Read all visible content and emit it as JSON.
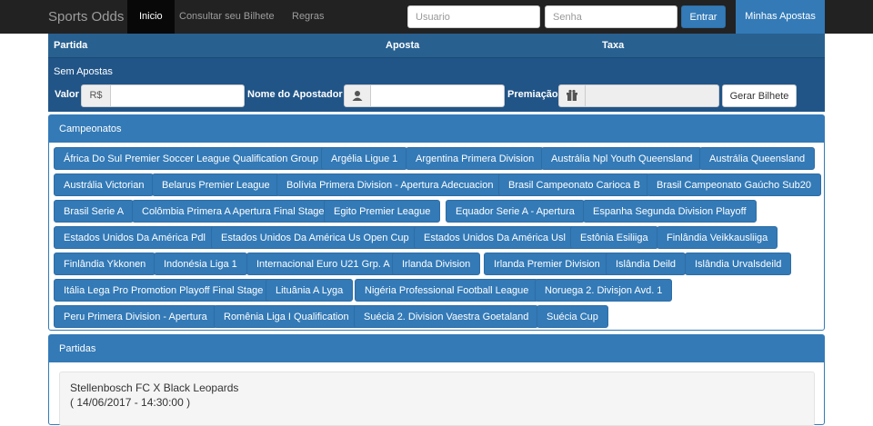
{
  "navbar": {
    "brand": "Sports Odds",
    "links": [
      "Inicio",
      "Consultar seu Bilhete",
      "Regras"
    ],
    "username_placeholder": "Usuario",
    "password_placeholder": "Senha",
    "login_label": "Entrar",
    "my_bets_label": "Minhas Apostas"
  },
  "slip": {
    "columns": [
      "Partida",
      "Aposta",
      "Taxa"
    ],
    "empty_text": "Sem Apostas",
    "valor_label": "Valor",
    "currency": "R$",
    "name_label": "Nome do Apostador",
    "prize_label": "Premiação",
    "generate_label": "Gerar Bilhete"
  },
  "campeonatos": {
    "title": "Campeonatos",
    "items": [
      "África Do Sul Premier Soccer League Qualification Group",
      "Argélia Ligue 1",
      "Argentina Primera Division",
      "Austrália Npl Youth Queensland",
      "Austrália Queensland",
      "Austrália Victorian",
      "Belarus Premier League",
      "Bolívia Primera Division - Apertura Adecuacion",
      "Brasil Campeonato Carioca B",
      "Brasil Campeonato Gaúcho Sub20",
      "Brasil Serie A",
      "Colômbia Primera A Apertura Final Stage",
      "Egito Premier League",
      "Equador Serie A - Apertura",
      "Espanha Segunda Division Playoff",
      "Estados Unidos Da América Pdl",
      "Estados Unidos Da América Us Open Cup",
      "Estados Unidos Da América Usl",
      "Estônia Esiliiga",
      "Finlândia Veikkausliiga",
      "Finlândia Ykkonen",
      "Indonésia Liga 1",
      "Internacional Euro U21 Grp. A",
      "Irlanda Division",
      "Irlanda Premier Division",
      "Islândia Deild",
      "Islândia Urvalsdeild",
      "Itália Lega Pro Promotion Playoff Final Stage",
      "Lituânia A Lyga",
      "Nigéria Professional Football League",
      "Noruega 2. Divisjon Avd. 1",
      "Peru Primera Division - Apertura",
      "Romênia Liga I Qualification",
      "Suécia 2. Division Vaestra Goetaland",
      "Suécia Cup"
    ]
  },
  "partidas": {
    "title": "Partidas",
    "matches": [
      {
        "teams": "Stellenbosch FC X Black Leopards",
        "datetime": "( 14/06/2017 - 14:30:00 )"
      }
    ]
  },
  "colors": {
    "primary": "#337ab7",
    "navbar": "#222222",
    "slip": "#215588"
  },
  "icons": {
    "user": "user-icon",
    "gift": "gift-icon"
  }
}
